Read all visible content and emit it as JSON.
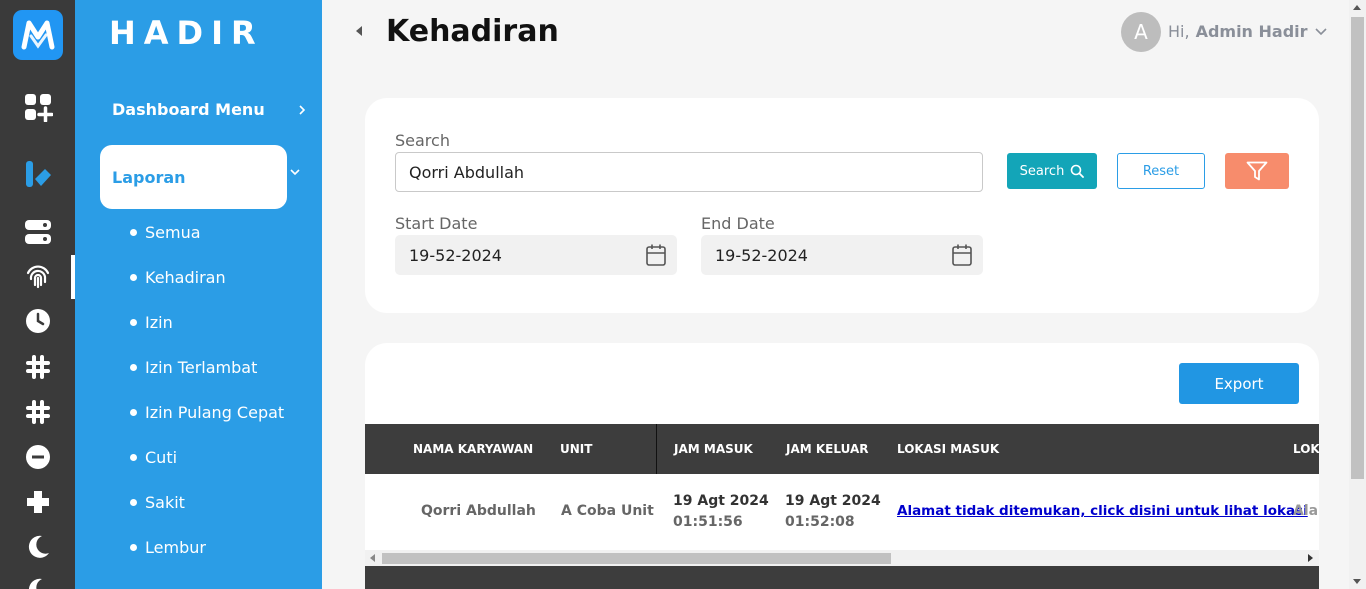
{
  "brand": "HADIR",
  "page_title": "Kehadiran",
  "user": {
    "avatar_letter": "A",
    "greeting": "Hi,",
    "name": "Admin Hadir"
  },
  "menu": {
    "dashboard_label": "Dashboard Menu",
    "section_label": "Laporan",
    "sub_items": [
      "Semua",
      "Kehadiran",
      "Izin",
      "Izin Terlambat",
      "Izin Pulang Cepat",
      "Cuti",
      "Sakit",
      "Lembur"
    ]
  },
  "rail_icons": [
    "app-grid-icon",
    "brand-b-icon",
    "server-icon",
    "fingerprint-icon",
    "clock-icon",
    "hashtag-icon",
    "hashtag-icon",
    "minus-circle-icon",
    "plus-icon",
    "moon-icon",
    "moon-icon"
  ],
  "filters": {
    "search_label": "Search",
    "search_value": "Qorri Abdullah",
    "search_button": "Search",
    "reset_button": "Reset",
    "start_label": "Start Date",
    "start_value": "19-52-2024",
    "end_label": "End Date",
    "end_value": "19-52-2024"
  },
  "table": {
    "export_button": "Export",
    "headers": [
      "NAMA KARYAWAN",
      "UNIT",
      "JAM MASUK",
      "JAM KELUAR",
      "LOKASI MASUK",
      "LOKA"
    ],
    "row": {
      "name": "Qorri Abdullah",
      "unit": "A Coba Unit",
      "in_date": "19 Agt 2024",
      "in_time": "01:51:56",
      "out_date": "19 Agt 2024",
      "out_time": "01:52:08",
      "location_in": "Alamat tidak ditemukan, click disini untuk lihat lokasi",
      "location_out_partial": "Alan"
    }
  },
  "colors": {
    "rail": "#3a3a3a",
    "menu": "#2b9de6",
    "search_btn": "#13a5b8",
    "filter_btn": "#f78c6c",
    "export_btn": "#2196e3",
    "table_head": "#3d3d3d"
  }
}
